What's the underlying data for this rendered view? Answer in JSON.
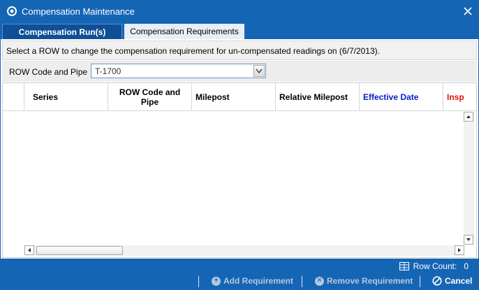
{
  "window": {
    "title": "Compensation Maintenance"
  },
  "tabs": [
    {
      "label": "Compensation Run(s)",
      "active": true
    },
    {
      "label": "Compensation Requirements",
      "active": false
    }
  ],
  "info": {
    "text": "Select a ROW to change the compensation requirement for un-compensated readings on (6/7/2013)."
  },
  "filter": {
    "label": "ROW Code and Pipe",
    "value": "T-1700"
  },
  "grid": {
    "columns": [
      {
        "label": "Series",
        "color": "#000000"
      },
      {
        "label": "ROW Code and Pipe",
        "color": "#000000"
      },
      {
        "label": "Milepost",
        "color": "#000000"
      },
      {
        "label": "Relative Milepost",
        "color": "#000000"
      },
      {
        "label": "Effective Date",
        "color": "#0a1cc8"
      },
      {
        "label": "Insp",
        "color": "#e01010"
      }
    ],
    "rows": []
  },
  "status": {
    "row_count_label": "Row Count:",
    "row_count": "0"
  },
  "actions": {
    "add_label": "Add Requirement",
    "remove_label": "Remove Requirement",
    "cancel_label": "Cancel"
  },
  "colors": {
    "brand": "#1565b5"
  }
}
